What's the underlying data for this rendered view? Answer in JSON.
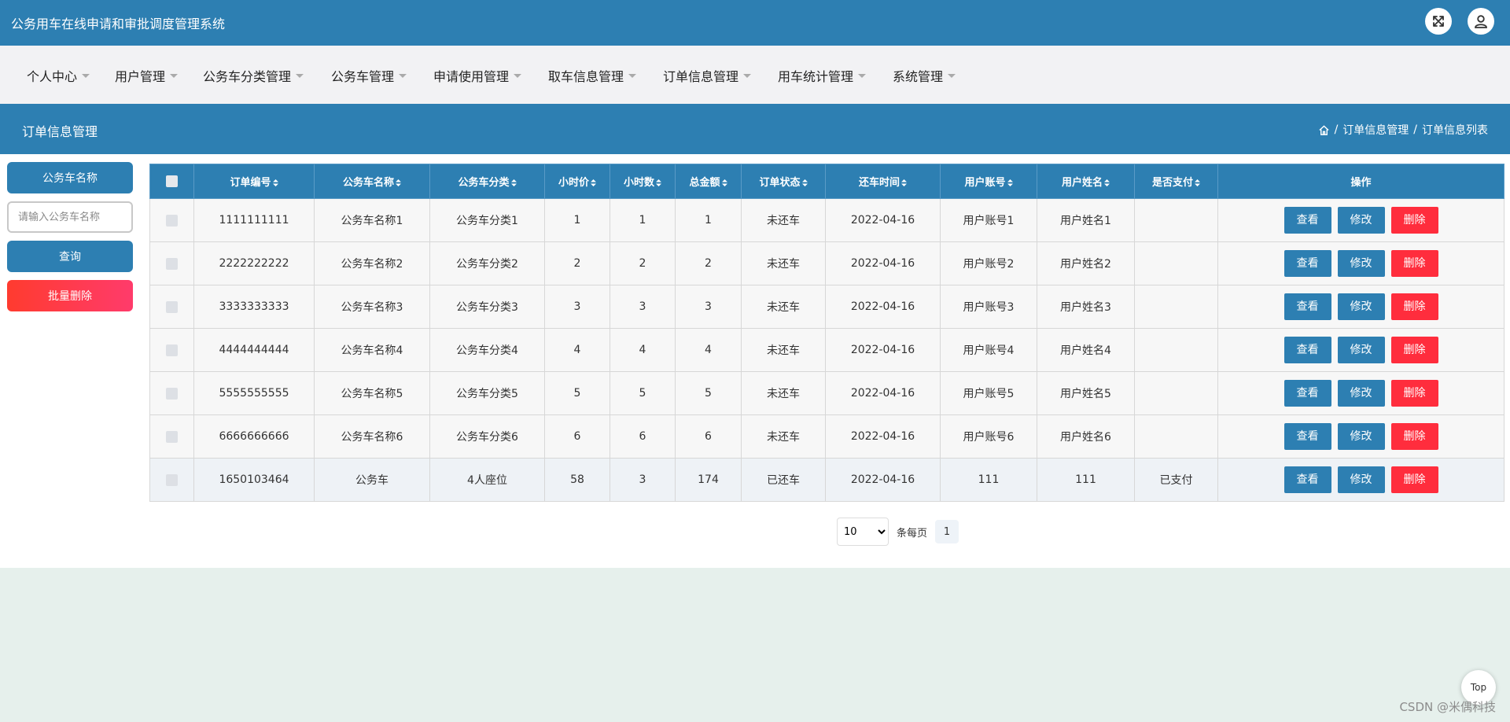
{
  "app": {
    "title": "公务用车在线申请和审批调度管理系统"
  },
  "menu": [
    {
      "label": "个人中心"
    },
    {
      "label": "用户管理"
    },
    {
      "label": "公务车分类管理"
    },
    {
      "label": "公务车管理"
    },
    {
      "label": "申请使用管理"
    },
    {
      "label": "取车信息管理"
    },
    {
      "label": "订单信息管理"
    },
    {
      "label": "用车统计管理"
    },
    {
      "label": "系统管理"
    }
  ],
  "page": {
    "title": "订单信息管理"
  },
  "breadcrumb": {
    "section": "订单信息管理",
    "current": "订单信息列表",
    "separator": "/"
  },
  "search": {
    "label": "公务车名称",
    "placeholder": "请输入公务车名称",
    "query_label": "查询",
    "batch_delete_label": "批量删除"
  },
  "table": {
    "headers": [
      "订单编号",
      "公务车名称",
      "公务车分类",
      "小时价",
      "小时数",
      "总金额",
      "订单状态",
      "还车时间",
      "用户账号",
      "用户姓名",
      "是否支付",
      "操作"
    ],
    "rows": [
      {
        "order_no": "1111111111",
        "car_name": "公务车名称1",
        "category": "公务车分类1",
        "hourly_price": "1",
        "hours": "1",
        "total": "1",
        "status": "未还车",
        "return_time": "2022-04-16",
        "account": "用户账号1",
        "user_name": "用户姓名1",
        "paid": ""
      },
      {
        "order_no": "2222222222",
        "car_name": "公务车名称2",
        "category": "公务车分类2",
        "hourly_price": "2",
        "hours": "2",
        "total": "2",
        "status": "未还车",
        "return_time": "2022-04-16",
        "account": "用户账号2",
        "user_name": "用户姓名2",
        "paid": ""
      },
      {
        "order_no": "3333333333",
        "car_name": "公务车名称3",
        "category": "公务车分类3",
        "hourly_price": "3",
        "hours": "3",
        "total": "3",
        "status": "未还车",
        "return_time": "2022-04-16",
        "account": "用户账号3",
        "user_name": "用户姓名3",
        "paid": ""
      },
      {
        "order_no": "4444444444",
        "car_name": "公务车名称4",
        "category": "公务车分类4",
        "hourly_price": "4",
        "hours": "4",
        "total": "4",
        "status": "未还车",
        "return_time": "2022-04-16",
        "account": "用户账号4",
        "user_name": "用户姓名4",
        "paid": ""
      },
      {
        "order_no": "5555555555",
        "car_name": "公务车名称5",
        "category": "公务车分类5",
        "hourly_price": "5",
        "hours": "5",
        "total": "5",
        "status": "未还车",
        "return_time": "2022-04-16",
        "account": "用户账号5",
        "user_name": "用户姓名5",
        "paid": ""
      },
      {
        "order_no": "6666666666",
        "car_name": "公务车名称6",
        "category": "公务车分类6",
        "hourly_price": "6",
        "hours": "6",
        "total": "6",
        "status": "未还车",
        "return_time": "2022-04-16",
        "account": "用户账号6",
        "user_name": "用户姓名6",
        "paid": ""
      },
      {
        "order_no": "1650103464",
        "car_name": "公务车",
        "category": "4人座位",
        "hourly_price": "58",
        "hours": "3",
        "total": "174",
        "status": "已还车",
        "return_time": "2022-04-16",
        "account": "111",
        "user_name": "111",
        "paid": "已支付"
      }
    ],
    "actions": {
      "view": "查看",
      "edit": "修改",
      "delete": "删除"
    }
  },
  "pagination": {
    "page_size": "10",
    "page_size_options": [
      "10"
    ],
    "per_page_label": "条每页",
    "current_page": "1"
  },
  "back_to_top": "Top",
  "watermark": "CSDN @米偶科技",
  "colors": {
    "primary": "#2d7fb2",
    "danger": "#ff2d3d",
    "background": "#e6f0ec"
  }
}
